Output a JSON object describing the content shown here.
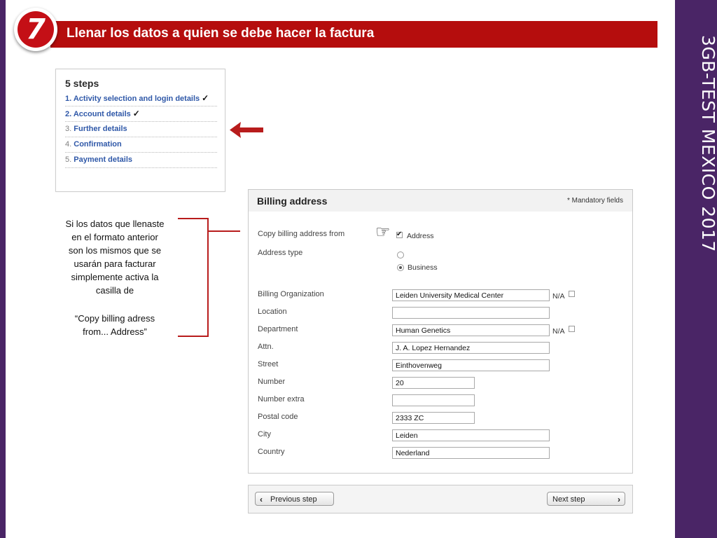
{
  "slide": {
    "step_number": "7",
    "header_title": "Llenar los datos a quien se debe hacer la factura",
    "side_title": "3GB-TEST MEXICO 2017",
    "colors": {
      "header_red": "#b50d0d",
      "side_purple": "#4a2566",
      "link_blue": "#2f58a8"
    }
  },
  "steps_panel": {
    "title": "5 steps",
    "items": [
      {
        "num": "1.",
        "label": "Activity selection and login details",
        "done": "✓"
      },
      {
        "num": "2.",
        "label": "Account details",
        "done": "✓"
      },
      {
        "num": "3.",
        "label": "Further details",
        "done": ""
      },
      {
        "num": "4.",
        "label": "Confirmation",
        "done": ""
      },
      {
        "num": "5.",
        "label": "Payment details",
        "done": ""
      }
    ]
  },
  "annotation": {
    "text": "Si los datos que llenaste en el formato anterior son los mismos que se usarán para facturar simplemente activa la casilla de",
    "quote": "“Copy billing adress from... Address”",
    "icons": [
      "arrow-left-icon",
      "pointing-hand-icon"
    ]
  },
  "billing": {
    "title": "Billing address",
    "mandatory": "* Mandatory fields",
    "copy_label": "Copy billing address from",
    "copy_option": "Address",
    "copy_checked": true,
    "address_type_label": "Address type",
    "address_type_selected": "Business",
    "address_type_option2": "Business",
    "na_label": "N/A",
    "fields": {
      "organization": {
        "label": "Billing Organization",
        "value": "Leiden University Medical Center"
      },
      "location": {
        "label": "Location",
        "value": ""
      },
      "department": {
        "label": "Department",
        "value": "Human Genetics"
      },
      "attn": {
        "label": "Attn.",
        "value": "J. A. Lopez Hernandez"
      },
      "street": {
        "label": "Street",
        "value": "Einthovenweg"
      },
      "number": {
        "label": "Number",
        "value": "20"
      },
      "number_extra": {
        "label": "Number extra",
        "value": ""
      },
      "postal_code": {
        "label": "Postal code",
        "value": "2333 ZC"
      },
      "city": {
        "label": "City",
        "value": "Leiden"
      },
      "country": {
        "label": "Country",
        "value": "Nederland"
      }
    }
  },
  "navigation": {
    "prev_label": "Previous step",
    "next_label": "Next step"
  }
}
